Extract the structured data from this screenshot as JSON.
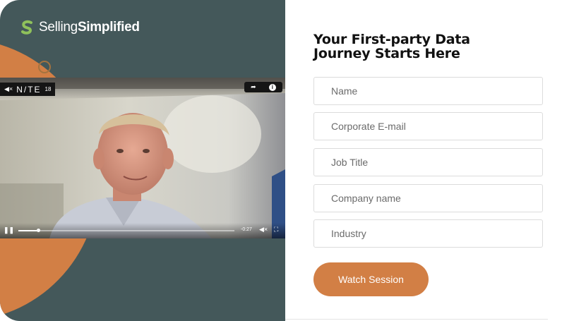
{
  "brand": {
    "logo_part1": "Selling",
    "logo_part2": "Simplified"
  },
  "video": {
    "overlay_brand": "N/TE",
    "overlay_brand_suffix": "18",
    "time": "-0:27",
    "progress": 0.09
  },
  "form": {
    "title_line1": "Your First-party Data",
    "title_line2": "Journey Starts Here",
    "fields": {
      "name": "Name",
      "email": "Corporate E-mail",
      "job_title": "Job Title",
      "company": "Company name",
      "industry": "Industry"
    },
    "submit_label": "Watch Session"
  },
  "colors": {
    "panel": "#44585a",
    "accent": "#d27f45",
    "logo_green": "#8fc15b"
  }
}
